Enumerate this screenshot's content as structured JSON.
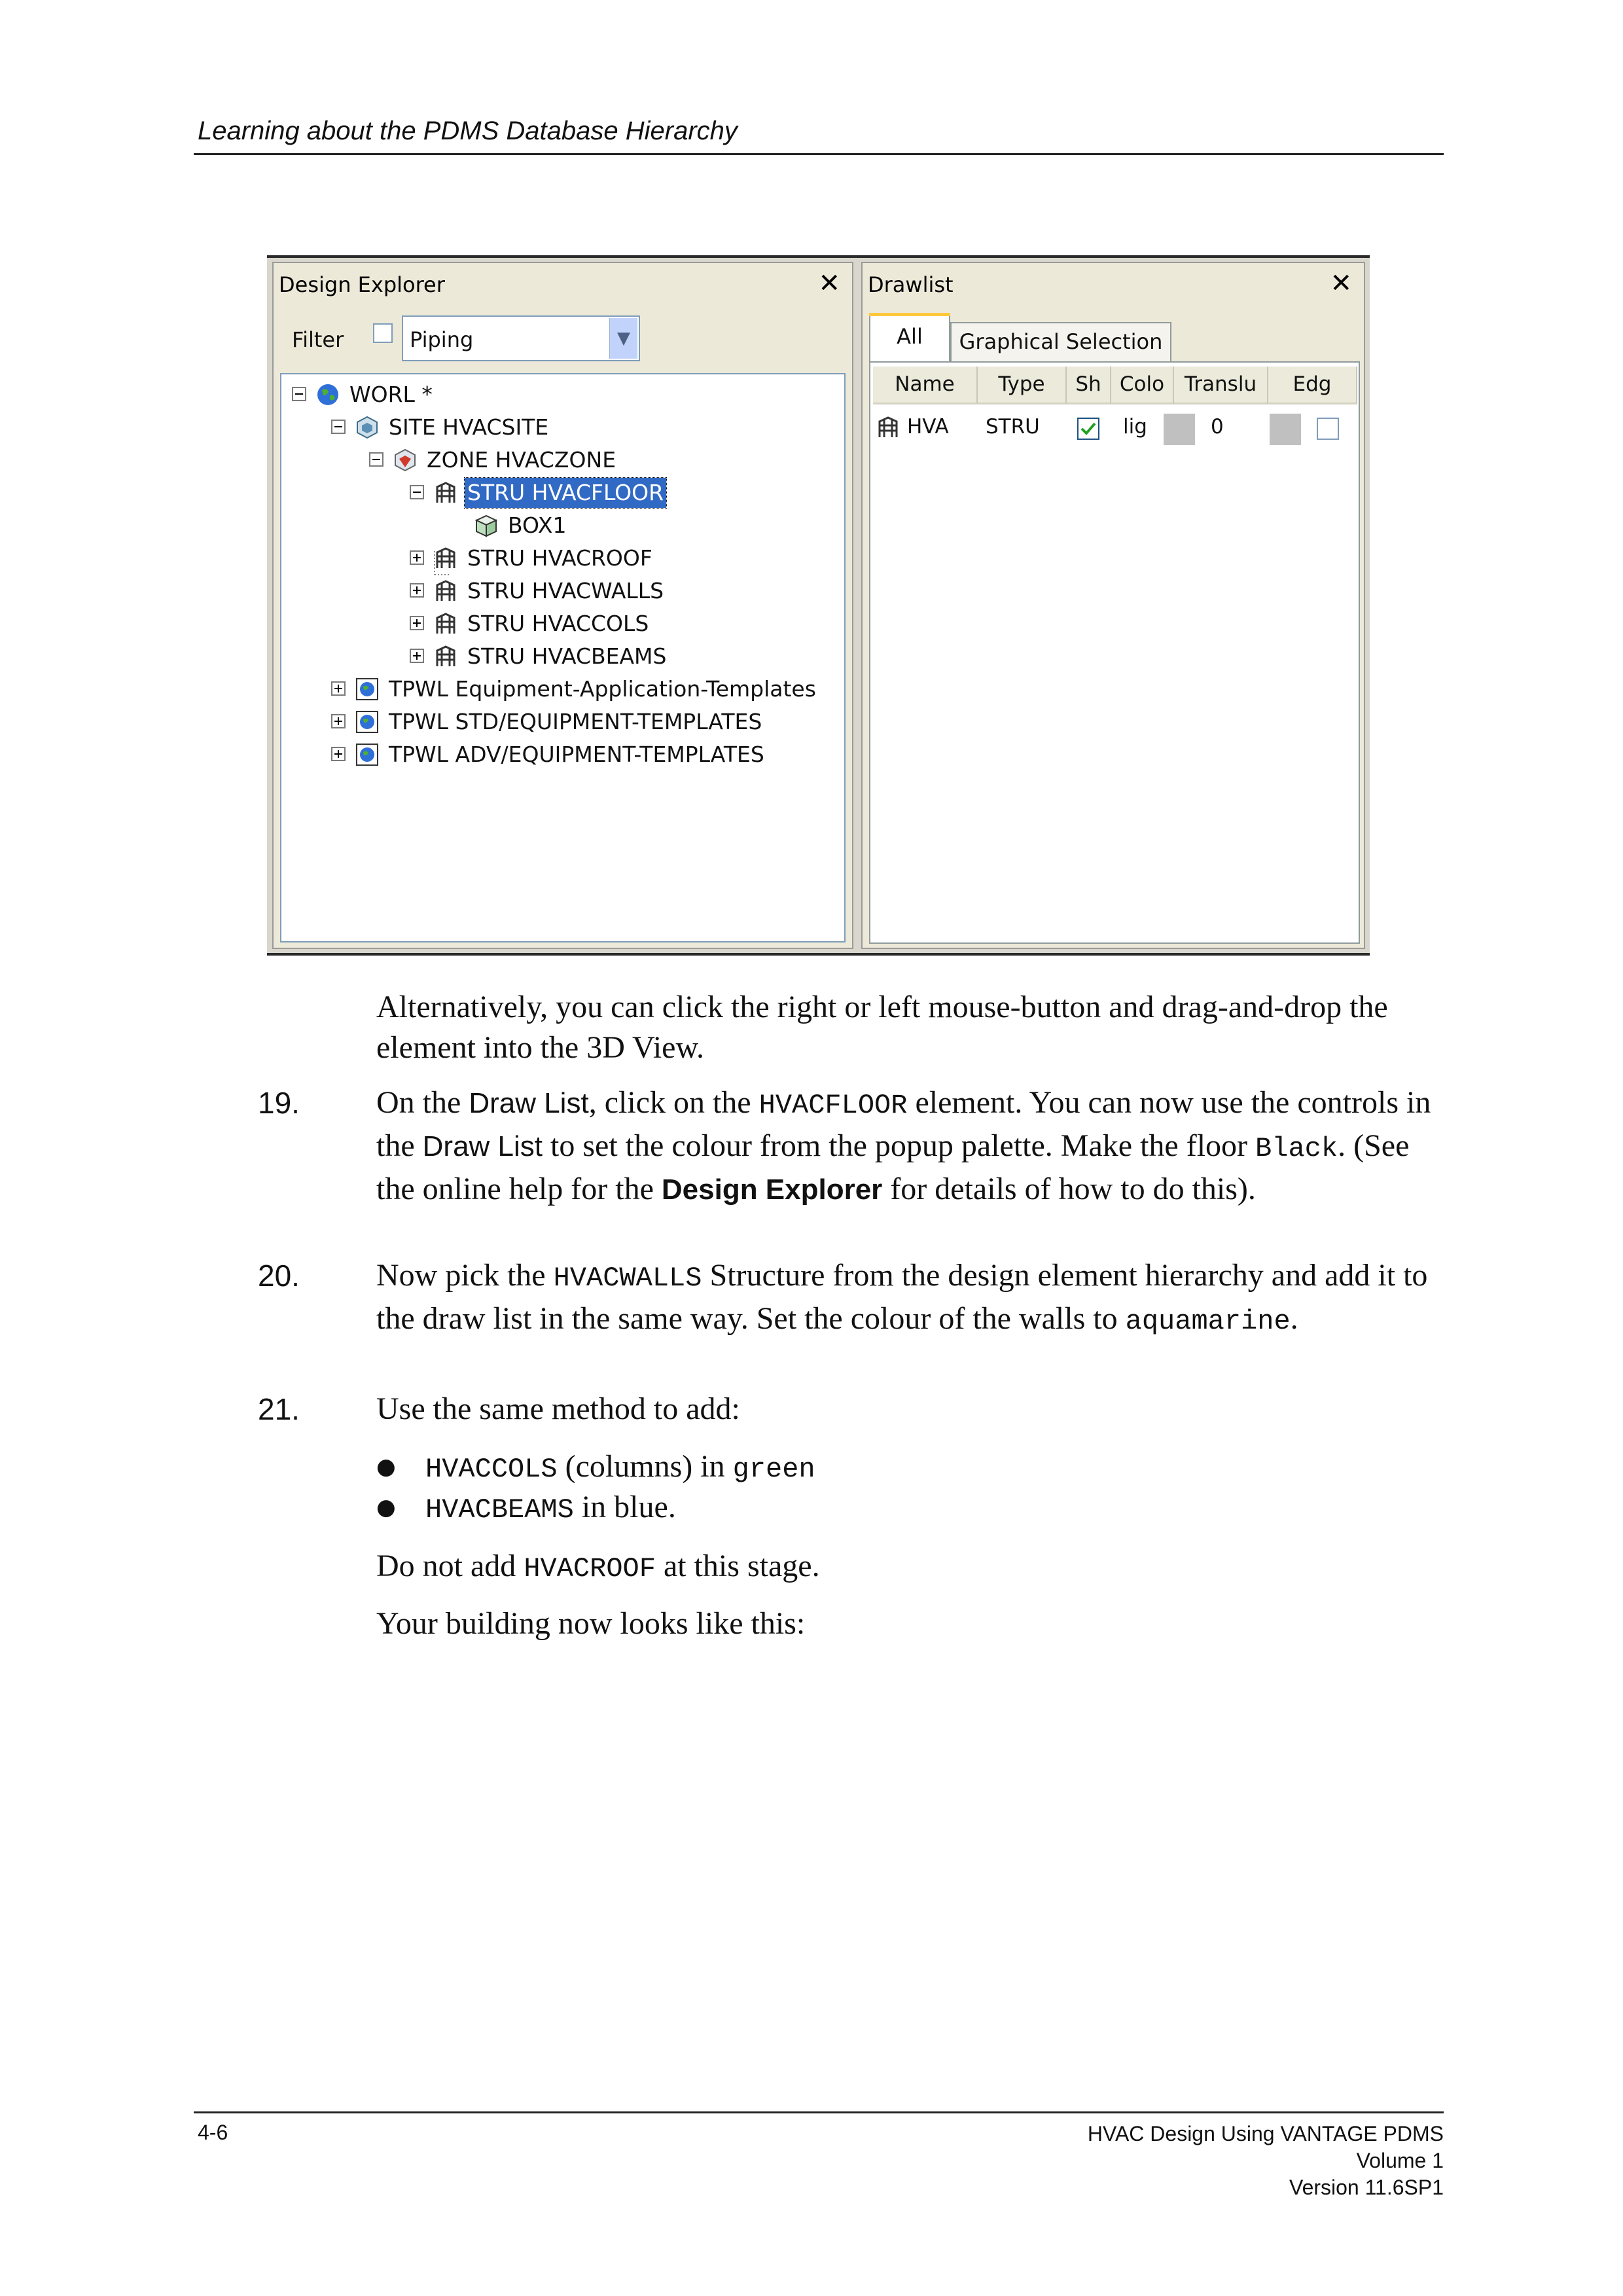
{
  "header": {
    "running_title": "Learning about the PDMS Database Hierarchy"
  },
  "footer": {
    "page_number": "4-6",
    "book_title": "HVAC Design Using VANTAGE PDMS",
    "volume": "Volume 1",
    "version": "Version 11.6SP1"
  },
  "design_explorer": {
    "title": "Design Explorer",
    "close": "✕",
    "filter_label": "Filter",
    "filter_checked": false,
    "filter_value": "Piping",
    "tree": [
      {
        "label": "WORL *",
        "icon": "world-icon",
        "expander": "minus",
        "selected": false
      },
      {
        "label": "SITE HVACSITE",
        "icon": "site-icon",
        "expander": "minus",
        "selected": false
      },
      {
        "label": "ZONE HVACZONE",
        "icon": "zone-icon",
        "expander": "minus",
        "selected": false
      },
      {
        "label": "STRU HVACFLOOR",
        "icon": "structure-icon",
        "expander": "minus",
        "selected": true
      },
      {
        "label": "BOX1",
        "icon": "box-icon",
        "expander": "none",
        "selected": false
      },
      {
        "label": "STRU HVACROOF",
        "icon": "structure-icon",
        "expander": "plus",
        "selected": false
      },
      {
        "label": "STRU HVACWALLS",
        "icon": "structure-icon",
        "expander": "plus",
        "selected": false
      },
      {
        "label": "STRU HVACCOLS",
        "icon": "structure-icon",
        "expander": "plus",
        "selected": false
      },
      {
        "label": "STRU HVACBEAMS",
        "icon": "structure-icon",
        "expander": "plus",
        "selected": false
      },
      {
        "label": "TPWL Equipment-Application-Templates",
        "icon": "template-world-icon",
        "expander": "plus",
        "selected": false
      },
      {
        "label": "TPWL STD/EQUIPMENT-TEMPLATES",
        "icon": "template-world-icon",
        "expander": "plus",
        "selected": false
      },
      {
        "label": "TPWL ADV/EQUIPMENT-TEMPLATES",
        "icon": "template-world-icon",
        "expander": "plus",
        "selected": false
      }
    ]
  },
  "drawlist": {
    "title": "Drawlist",
    "close": "✕",
    "tabs": [
      "All",
      "Graphical Selection"
    ],
    "active_tab": "All",
    "columns": [
      "Name",
      "Type",
      "Sh",
      "Colo",
      "Translu",
      "Edg"
    ],
    "rows": [
      {
        "name": "HVA",
        "type": "STRU",
        "shown": true,
        "colour": "lig",
        "colour_swatch": "#c0c0c0",
        "translucency": "0",
        "edge_swatch": "#c0c0c0",
        "edges": false
      }
    ]
  },
  "body": {
    "intro": "Alternatively, you can click the right or left mouse-button and drag-and-drop the element into the 3D View.",
    "step19": {
      "number": "19.",
      "t1": "On the ",
      "ui1": "Draw List",
      "t2": ", click on the ",
      "code1": "HVACFLOOR",
      "t3": " element. You can now use the controls in the ",
      "ui2": "Draw List",
      "t4": " to set the colour from the popup palette. Make the floor ",
      "code2": "Black",
      "t5": ". (See the online help for the ",
      "ui3": "Design Explorer",
      "t6": " for details of how to do this)."
    },
    "step20": {
      "number": "20.",
      "t1": "Now pick the ",
      "code1": "HVACWALLS",
      "t2": " Structure from the design element hierarchy and add it to the draw list in the same way. Set the colour of the walls to ",
      "code2": "aquamarine",
      "t3": "."
    },
    "step21": {
      "number": "21.",
      "text": "Use the same method to add:"
    },
    "bullet1": {
      "code": "HVACCOLS",
      "t1": " (columns) in ",
      "code2": "green"
    },
    "bullet2": {
      "code": "HVACBEAMS",
      "t1": " in blue."
    },
    "note1": {
      "t1": "Do not add ",
      "code": "HVACROOF",
      "t2": " at this stage."
    },
    "note2": "Your building now looks like this:"
  },
  "colors": {
    "selection": "#316ac5",
    "pane_bg": "#ece9d8",
    "tab_highlight": "#ffc73c",
    "check_green": "#21a121"
  }
}
